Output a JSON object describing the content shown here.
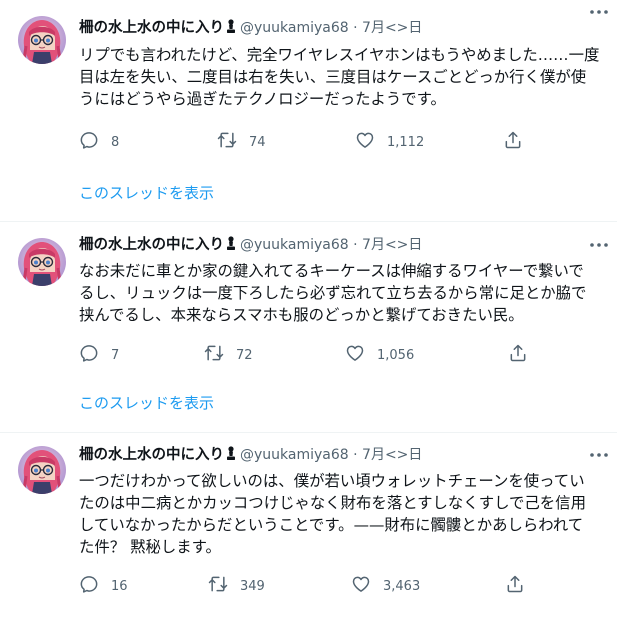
{
  "author": {
    "display_name": "柵の水上水の中に入り",
    "badge_icon": "chess-pawn-icon",
    "handle": "@yuukamiya68",
    "separator": "·",
    "date": "7月<>日"
  },
  "thread_link_label": "このスレッドを表示",
  "tweets": [
    {
      "lines": [
        "リプでも言われたけど、完全ワイヤレスイヤホンはもうやめました……一度",
        "目は左を失い、二度目は右を失い、三度目はケースごとどっか行く僕が使",
        "うにはどうやら過ぎたテクノロジーだったようです。"
      ],
      "replies": "8",
      "retweets": "74",
      "likes": "1,112"
    },
    {
      "lines": [
        "なお未だに車とか家の鍵入れてるキーケースは伸縮するワイヤーで繋いで",
        "るし、リュックは一度下ろしたら必ず忘れて立ち去るから常に足とか脇で",
        "挟んでるし、本来ならスマホも服のどっかと繋げておきたい民。"
      ],
      "replies": "7",
      "retweets": "72",
      "likes": "1,056"
    },
    {
      "lines": [
        "一つだけわかって欲しいのは、僕が若い頃ウォレットチェーンを使ってい",
        "たのは中二病とかカッコつけじゃなく財布を落とすしなくすしで己を信用",
        "していなかったからだということです。——財布に髑髏とかあしらわれて",
        "た件？ 黙秘します。"
      ],
      "replies": "16",
      "retweets": "349",
      "likes": "3,463"
    }
  ],
  "colors": {
    "text": "#0f1419",
    "secondary": "#536471",
    "link": "#1d9bf0",
    "divider": "#eff3f4",
    "avatar_ring": "#b8a3d8",
    "avatar_hair": "#e2517a"
  }
}
